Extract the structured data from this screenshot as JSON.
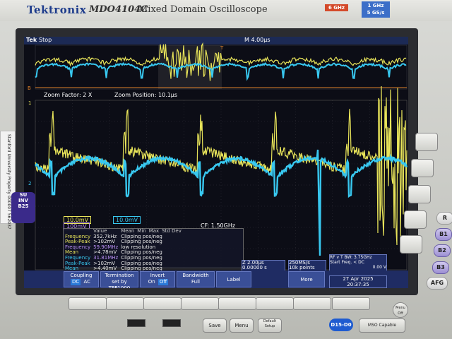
{
  "device": {
    "brand": "Tektronix",
    "model": "MDO4104C",
    "model_name": "Mixed Domain Oscilloscope",
    "badge_ghz": "6 GHz",
    "badge_bw": "1 GHz",
    "badge_rate": "5 GS/s"
  },
  "status": {
    "logo": "Tek",
    "state": "Stop",
    "timebase": "M 4.00µs"
  },
  "zoom": {
    "factor": "Zoom Factor: 2 X",
    "position": "Zoom Position: 10.1µs"
  },
  "channels": {
    "ch1_scale": "10.0mV",
    "ch2_scale": "10.0mV",
    "ch_b_scale": "100mV",
    "cf": "CF: 1.50GHz",
    "marker1": "1",
    "marker2": "2"
  },
  "measurements": {
    "headers": [
      "",
      "Value",
      "Mean",
      "Min",
      "Max",
      "Std Dev"
    ],
    "rows": [
      {
        "ch": "1",
        "name": "Frequency",
        "value": "352.7kHz",
        "note": "Clipping pos/neg",
        "color": "ylw"
      },
      {
        "ch": "1",
        "name": "Peak-Peak",
        "value": ">102mV",
        "note": "Clipping pos/neg",
        "color": "ylw"
      },
      {
        "ch": "1",
        "name": "Frequency",
        "value": "59.90MHz",
        "note": "low resolution",
        "color": "pur"
      },
      {
        "ch": "1",
        "name": "Mean",
        "value": ">4.78mV",
        "note": "Clipping pos/neg",
        "color": "ylw"
      },
      {
        "ch": "2",
        "name": "Frequency",
        "value": "31.81MHz",
        "note": "Clipping pos/neg",
        "color": "cya"
      },
      {
        "ch": "2",
        "name": "Peak-Peak",
        "value": ">102mV",
        "note": "Clipping pos/neg",
        "color": "cya"
      },
      {
        "ch": "2",
        "name": "Mean",
        "value": ">4.40mV",
        "note": "Clipping pos/neg",
        "color": "cya"
      }
    ]
  },
  "horizontal": {
    "zoom_scale": "Z 2.00µs",
    "position": "0.00000 s",
    "rate": "250MS/s",
    "points": "10k points"
  },
  "rf": {
    "line1": "RF v T  BW: 3.75GHz",
    "line2": "Start Freq. < DC",
    "trig_value": "0.00 V"
  },
  "datetime": {
    "date": "27 Apr 2025",
    "time": "20:37:35"
  },
  "menu": {
    "coupling_label": "Coupling",
    "coupling_opt1": "DC",
    "coupling_opt2": "AC",
    "termination_label": "Termination",
    "termination_value": "set by TPP1000",
    "invert_label": "Invert",
    "invert_opt1": "On",
    "invert_opt2": "Off",
    "bandwidth_label": "Bandwidth",
    "bandwidth_value": "Full",
    "label_button": "Label",
    "more_button": "More"
  },
  "front_panel": {
    "side_keys": [
      "R",
      "B1",
      "B2",
      "B3"
    ],
    "afg": "AFG",
    "menu_key": "Menu Off",
    "save": "Save",
    "menu": "Menu",
    "default_setup": "Default Setup",
    "d15": "D15-D0",
    "mso": "MSO Capable",
    "sticker": "Stanford University Property",
    "sticker_id": "000007 562037",
    "tag_line1": "SU",
    "tag_line2": "INV",
    "tag_line3": "B25"
  },
  "colors": {
    "ch1": "#e8e45a",
    "ch2": "#38c8f0",
    "menu_bg": "#1f2c63"
  }
}
